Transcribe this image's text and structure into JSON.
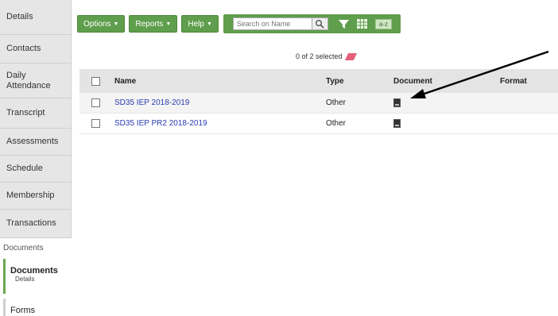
{
  "sidebar": {
    "tabs": [
      {
        "label": "Details"
      },
      {
        "label": "Contacts"
      },
      {
        "label": "Daily Attendance"
      },
      {
        "label": "Transcript"
      },
      {
        "label": "Assessments"
      },
      {
        "label": "Schedule"
      },
      {
        "label": "Membership"
      },
      {
        "label": "Transactions"
      }
    ],
    "section_label": "Documents",
    "subitems": [
      {
        "label": "Documents",
        "sublabel": "Details"
      },
      {
        "label": "Forms"
      }
    ]
  },
  "toolbar": {
    "options_label": "Options",
    "reports_label": "Reports",
    "help_label": "Help",
    "search_placeholder": "Search on Name",
    "sort_label": "a-z"
  },
  "selection": {
    "text": "0 of 2 selected"
  },
  "table": {
    "headers": {
      "name": "Name",
      "type": "Type",
      "document": "Document",
      "format": "Format"
    },
    "rows": [
      {
        "name": "SD35 IEP 2018-2019",
        "type": "Other"
      },
      {
        "name": "SD35 IEP PR2 2018-2019",
        "type": "Other"
      }
    ]
  },
  "colors": {
    "accent": "#5f9e4c",
    "link": "#2a3bb0"
  }
}
